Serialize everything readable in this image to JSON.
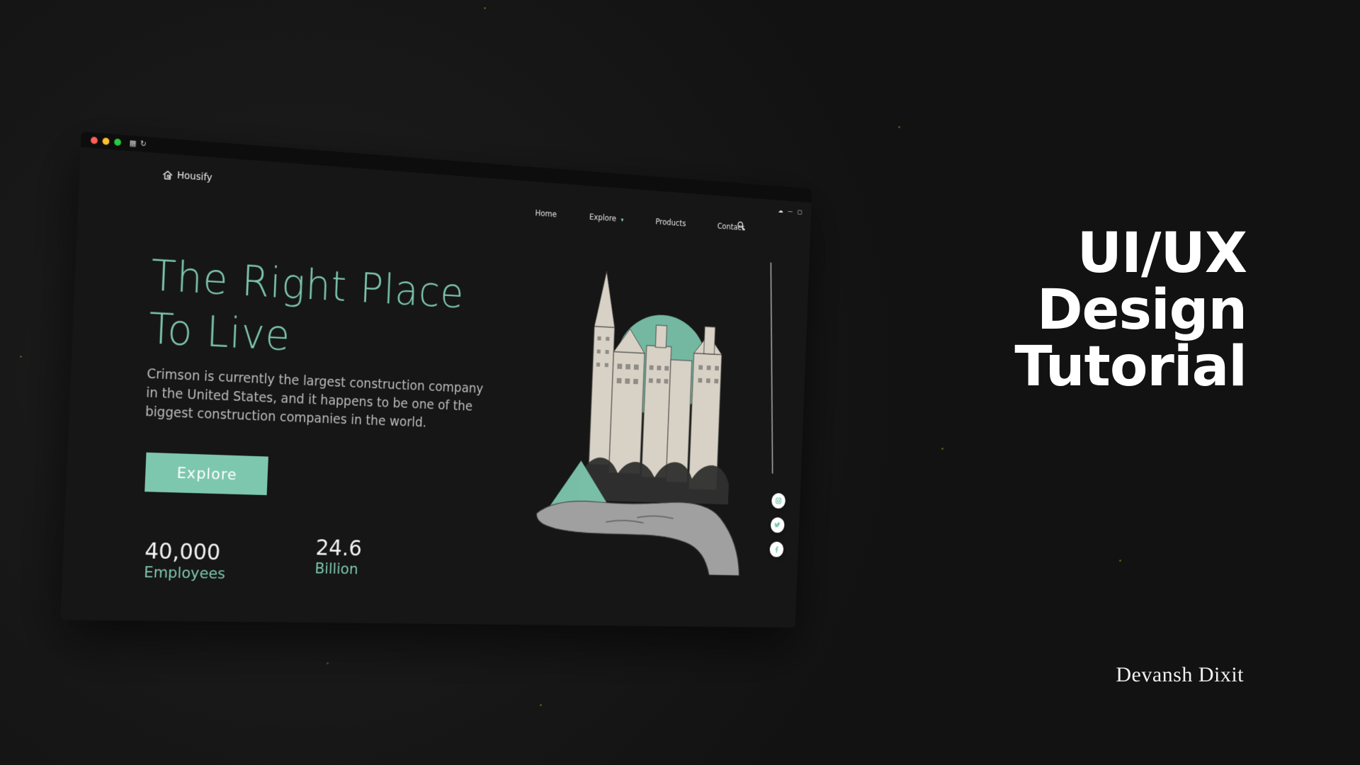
{
  "browser": {
    "titlebar": {
      "traffic_lights": [
        "close",
        "minimize",
        "maximize"
      ],
      "icons": [
        "grid-icon",
        "refresh-icon"
      ]
    }
  },
  "site": {
    "brand": {
      "name": "Housify",
      "icon": "house-search-icon"
    },
    "nav": {
      "items": [
        "Home",
        "Explore",
        "Products",
        "Contact"
      ],
      "search_icon": "search-icon",
      "window_controls": [
        "cloud-icon",
        "minus-icon",
        "square-icon"
      ]
    },
    "hero": {
      "title": "The Right Place\nTo Live",
      "description": "Crimson is currently the largest construction company in the United States, and it happens to be one of the biggest construction companies in the world.",
      "cta_label": "Explore"
    },
    "stats": [
      {
        "value": "40,000",
        "label": "Employees"
      },
      {
        "value": "24.6",
        "label": "Billion"
      }
    ],
    "social": [
      "instagram-icon",
      "twitter-icon",
      "facebook-icon"
    ]
  },
  "tutorial": {
    "title": "UI/UX\nDesign\nTutorial",
    "author": "Devansh Dixit"
  },
  "colors": {
    "background": "#121212",
    "panel": "#161616",
    "accent": "#7dc7ae",
    "text": "#f2f2f2",
    "muted": "#bdbdbd"
  }
}
